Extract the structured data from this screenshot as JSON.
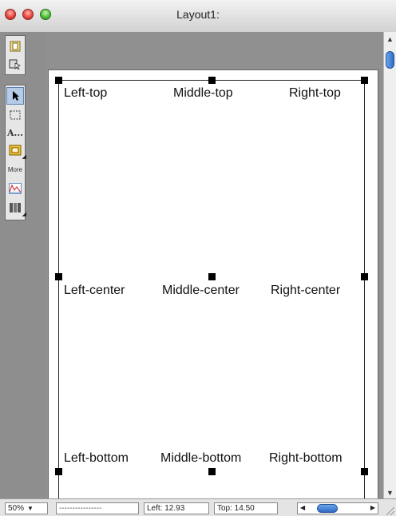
{
  "window": {
    "title": "Layout1:"
  },
  "toolbar": {
    "tools": [
      {
        "name": "browse-mode-icon"
      },
      {
        "name": "layout-mode-icon"
      },
      {
        "name": "pointer-icon"
      },
      {
        "name": "marquee-select-icon"
      },
      {
        "name": "text-tool-icon",
        "glyph": "A..."
      },
      {
        "name": "rectangle-tool-icon"
      },
      {
        "name": "more-tool-icon",
        "glyph": "More"
      },
      {
        "name": "chart-tool-icon"
      },
      {
        "name": "column-tool-icon"
      }
    ]
  },
  "layout": {
    "labels": {
      "left_top": "Left-top",
      "middle_top": "Middle-top",
      "right_top": "Right-top",
      "left_center": "Left-center",
      "middle_center": "Middle-center",
      "right_center": "Right-center",
      "left_bottom": "Left-bottom",
      "middle_bottom": "Middle-bottom",
      "right_bottom": "Right-bottom"
    }
  },
  "statusbar": {
    "zoom": "50%",
    "field_name": "----------------",
    "left_value": "Left: 12.93",
    "top_value": "Top: 14.50"
  },
  "colors": {
    "accent": "#2e6cc4",
    "canvas": "#909090"
  }
}
